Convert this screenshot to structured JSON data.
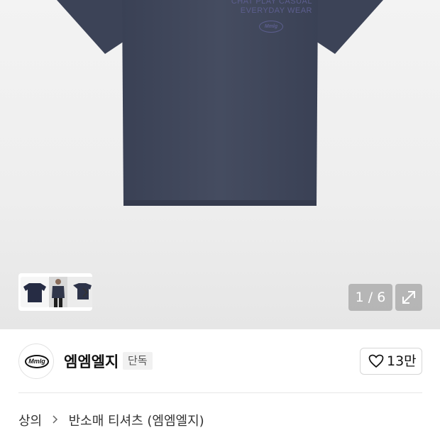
{
  "gallery": {
    "shirt_print_line1": "CHAT PLAY CASUAL",
    "shirt_print_line2": "EVERYDAY WEAR",
    "shirt_badge": "Mmlg",
    "counter": "1 / 6",
    "shirt_color": "#3f4659",
    "thumb_next_icon": "chevron-right-icon",
    "expand_icon": "expand-arrows-icon"
  },
  "brand": {
    "logo_text": "Mmlg",
    "name": "엠엠엘지",
    "badge": "단독"
  },
  "like": {
    "icon": "heart-outline-icon",
    "count": "13만"
  },
  "breadcrumb": {
    "items": [
      "상의",
      "반소매 티셔츠 (엠엠엘지)"
    ],
    "separator_icon": "chevron-right-icon"
  }
}
